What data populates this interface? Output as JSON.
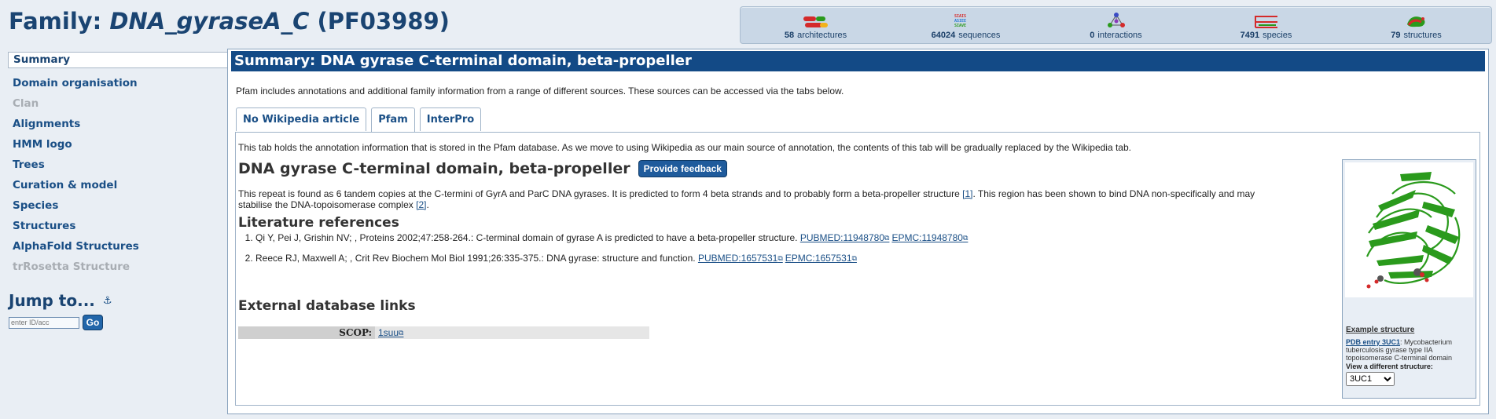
{
  "header": {
    "prefix": "Family: ",
    "family_name": "DNA_gyraseA_C",
    "accession": " (PF03989)"
  },
  "stats": [
    {
      "count": "58",
      "label": "architectures",
      "icon": "architectures-icon"
    },
    {
      "count": "64024",
      "label": "sequences",
      "icon": "sequences-icon"
    },
    {
      "count": "0",
      "label": "interactions",
      "icon": "interactions-icon"
    },
    {
      "count": "7491",
      "label": "species",
      "icon": "species-icon"
    },
    {
      "count": "79",
      "label": "structures",
      "icon": "structures-icon"
    }
  ],
  "sidebar": {
    "items": [
      {
        "label": "Summary"
      },
      {
        "label": "Domain organisation"
      },
      {
        "label": "Clan"
      },
      {
        "label": "Alignments"
      },
      {
        "label": "HMM logo"
      },
      {
        "label": "Trees"
      },
      {
        "label": "Curation & model"
      },
      {
        "label": "Species"
      },
      {
        "label": "Structures"
      },
      {
        "label": "AlphaFold Structures"
      },
      {
        "label": "trRosetta Structure"
      }
    ],
    "jump_title": "Jump to...",
    "jump_placeholder": "enter ID/acc",
    "go_label": "Go"
  },
  "main": {
    "title": "Summary: DNA gyrase C-terminal domain, beta-propeller",
    "intro": "Pfam includes annotations and additional family information from a range of different sources. These sources can be accessed via the tabs below.",
    "tabs": [
      {
        "label": "No Wikipedia article"
      },
      {
        "label": "Pfam"
      },
      {
        "label": "InterPro"
      }
    ],
    "tab_note": "This tab holds the annotation information that is stored in the Pfam database. As we move to using Wikipedia as our main source of annotation, the contents of this tab will be gradually replaced by the Wikipedia tab.",
    "family_heading": "DNA gyrase C-terminal domain, beta-propeller",
    "feedback_label": "Provide feedback",
    "description_part1": "This repeat is found as 6 tandem copies at the C-termini of GyrA and ParC DNA gyrases. It is predicted to form 4 beta strands and to probably form a beta-propeller structure ",
    "cite1": "[1]",
    "description_part2": ". This region has been shown to bind DNA non-specifically and may stabilise the DNA-topoisomerase complex ",
    "cite2": "[2]",
    "description_end": ".",
    "lit_heading": "Literature references",
    "refs": [
      {
        "text": "Qi Y, Pei J, Grishin NV; , Proteins 2002;47:258-264.: C-terminal domain of gyrase A is predicted to have a beta-propeller structure. ",
        "pubmed": "PUBMED:11948780",
        "epmc": "EPMC:11948780"
      },
      {
        "text": "Reece RJ, Maxwell A; , Crit Rev Biochem Mol Biol 1991;26:335-375.: DNA gyrase: structure and function. ",
        "pubmed": "PUBMED:1657531",
        "epmc": "EPMC:1657531"
      }
    ],
    "xdb_heading": "External database links",
    "xdb": {
      "label": "SCOP:",
      "value": "1suu"
    },
    "structure": {
      "caption_title": "Example structure",
      "pdb_link": "PDB entry 3UC1",
      "pdb_desc": ": Mycobacterium tuberculosis gyrase type IIA topoisomerase C-terminal domain",
      "view_label": "View a different structure:",
      "selected": "3UC1"
    }
  },
  "colors": {
    "header_text": "#1a4472",
    "title_bar": "#134a86",
    "link": "#1a4f86",
    "structure_green": "#2a9a1c"
  }
}
